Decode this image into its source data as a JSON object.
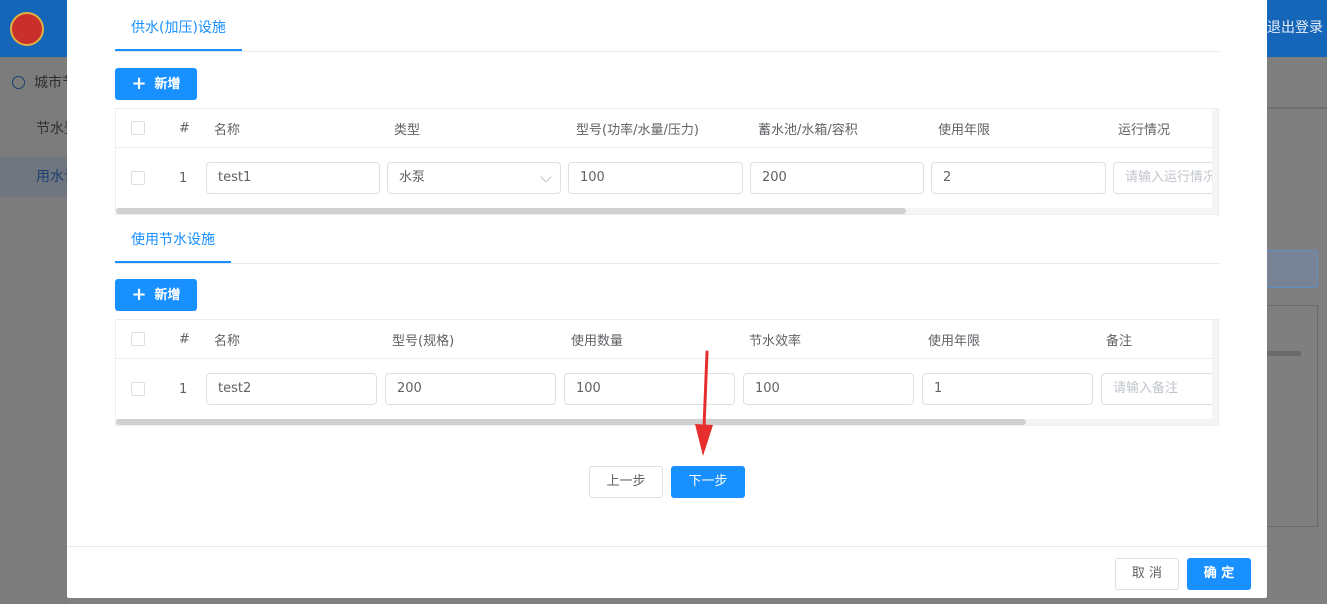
{
  "background": {
    "logout_label": "退出登录",
    "sidebar": {
      "top_label": "城市节",
      "items": [
        {
          "label": "节水登"
        },
        {
          "label": "用水计"
        }
      ]
    }
  },
  "section1": {
    "tab_label": "供水(加压)设施",
    "add_label": "新增",
    "columns": [
      "#",
      "名称",
      "类型",
      "型号(功率/水量/压力)",
      "蓄水池/水箱/容积",
      "使用年限",
      "运行情况"
    ],
    "rows": [
      {
        "index": "1",
        "name": "test1",
        "type": "水泵",
        "model": "100",
        "volume": "200",
        "years": "2",
        "status_placeholder": "请输入运行情况"
      }
    ]
  },
  "section2": {
    "tab_label": "使用节水设施",
    "add_label": "新增",
    "columns": [
      "#",
      "名称",
      "型号(规格)",
      "使用数量",
      "节水效率",
      "使用年限",
      "备注"
    ],
    "rows": [
      {
        "index": "1",
        "name": "test2",
        "model": "200",
        "quantity": "100",
        "efficiency": "100",
        "years": "1",
        "remark_placeholder": "请输入备注"
      }
    ]
  },
  "steps": {
    "prev_label": "上一步",
    "next_label": "下一步"
  },
  "footer": {
    "cancel_label": "取 消",
    "ok_label": "确 定"
  },
  "colors": {
    "primary": "#1890ff",
    "header_bg": "#1565b9",
    "annotation_arrow": "#e62e2e"
  }
}
